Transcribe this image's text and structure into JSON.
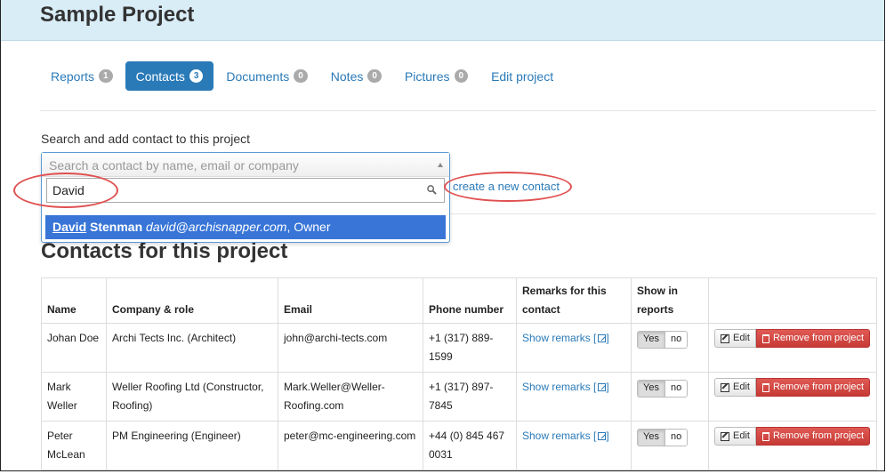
{
  "project": {
    "title": "Sample Project"
  },
  "tabs": [
    {
      "label": "Reports",
      "count": "1"
    },
    {
      "label": "Contacts",
      "count": "3"
    },
    {
      "label": "Documents",
      "count": "0"
    },
    {
      "label": "Notes",
      "count": "0"
    },
    {
      "label": "Pictures",
      "count": "0"
    },
    {
      "label": "Edit project",
      "count": ""
    }
  ],
  "search": {
    "label": "Search and add contact to this project",
    "placeholder": "Search a contact by name, email or company",
    "query": "David",
    "result": {
      "match": "David",
      "rest_name": " Stenman",
      "email": "david@archisnapper.com",
      "role": ", Owner"
    },
    "create_link": "create a new contact"
  },
  "contacts": {
    "title": "Contacts for this project",
    "headers": {
      "name": "Name",
      "company": "Company & role",
      "email": "Email",
      "phone": "Phone number",
      "remarks": "Remarks for this contact",
      "show": "Show in reports"
    },
    "rows": [
      {
        "name": "Johan Doe",
        "company": "Archi Tects Inc. (Architect)",
        "email": "john@archi-tects.com",
        "phone": "+1 (317) 889-1599",
        "remarks": "Show remarks",
        "yes": "Yes",
        "no": "no",
        "edit": "Edit",
        "remove": "Remove from project"
      },
      {
        "name": "Mark Weller",
        "company": "Weller Roofing Ltd (Constructor, Roofing)",
        "email": "Mark.Weller@Weller-Roofing.com",
        "phone": "+1 (317) 897-7845",
        "remarks": "Show remarks",
        "yes": "Yes",
        "no": "no",
        "edit": "Edit",
        "remove": "Remove from project"
      },
      {
        "name": "Peter McLean",
        "company": "PM Engineering (Engineer)",
        "email": "peter@mc-engineering.com",
        "phone": "+44 (0) 845 467 0031",
        "remarks": "Show remarks",
        "yes": "Yes",
        "no": "no",
        "edit": "Edit",
        "remove": "Remove from project"
      }
    ]
  },
  "colors": {
    "accent": "#2a7ab8",
    "header_bg": "#d9edf7",
    "highlight": "#3875d7",
    "danger": "#d9534f",
    "annotation": "#e05050"
  }
}
